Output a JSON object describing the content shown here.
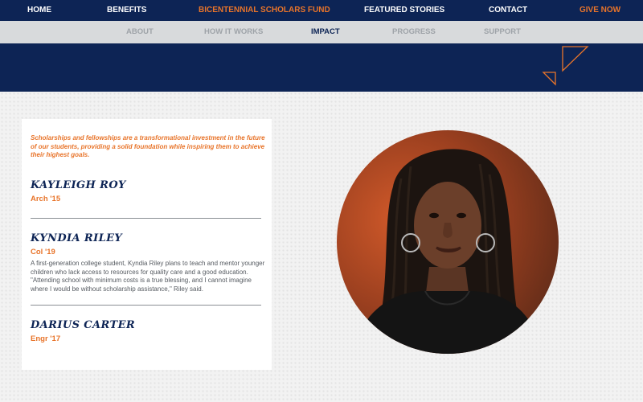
{
  "topnav": {
    "items": [
      {
        "label": "HOME"
      },
      {
        "label": "BENEFITS"
      },
      {
        "label": "BICENTENNIAL SCHOLARS FUND"
      },
      {
        "label": "FEATURED STORIES"
      },
      {
        "label": "CONTACT"
      },
      {
        "label": "GIVE NOW"
      }
    ]
  },
  "subnav": {
    "items": [
      {
        "label": "ABOUT"
      },
      {
        "label": "HOW IT WORKS"
      },
      {
        "label": "IMPACT"
      },
      {
        "label": "PROGRESS"
      },
      {
        "label": "SUPPORT"
      }
    ]
  },
  "card": {
    "intro": "Scholarships and fellowships are a transformational investment in the future of our students, providing a solid foundation while inspiring them to achieve their highest goals.",
    "scholars": [
      {
        "name": "KAYLEIGH ROY",
        "class": "Arch '15"
      },
      {
        "name": "KYNDIA RILEY",
        "class": "Col '19",
        "story": "A first-generation college student, Kyndia Riley plans to teach and mentor younger children who lack access to resources for quality care and a good education. \"Attending school with minimum costs is a true blessing, and I cannot imagine where I would be without scholarship assistance,\" Riley said."
      },
      {
        "name": "DARIUS CARTER",
        "class": "Engr '17"
      }
    ]
  },
  "colors": {
    "navy": "#0d2455",
    "orange": "#e8742a",
    "subnav_bg": "#d8dadc",
    "subnav_inactive": "#9ea3a8"
  }
}
